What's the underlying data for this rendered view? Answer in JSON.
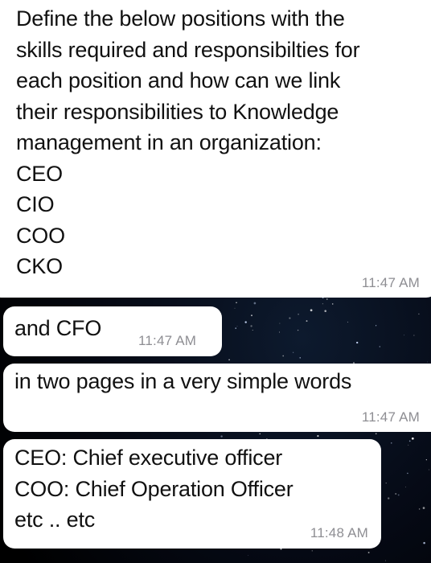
{
  "chat": {
    "messages": [
      {
        "text": "Define the below positions with the\nskills required and responsibilties for\neach position and how can we link\ntheir responsibilities to Knowledge\nmanagement in an organization:\nCEO\nCIO\nCOO\nCKO",
        "time": "11:47 AM"
      },
      {
        "text": "and CFO",
        "time": "11:47 AM"
      },
      {
        "text": "in two pages in a very simple words",
        "time": "11:47 AM"
      },
      {
        "text": "CEO: Chief executive officer\nCOO: Chief Operation Officer\netc .. etc",
        "time": "11:48 AM"
      }
    ],
    "colors": {
      "bubble": "#ffffff",
      "text": "#111111",
      "timestamp": "#8e8e93",
      "wallpaper": "#000000"
    },
    "wallpaper": "starry-night"
  }
}
